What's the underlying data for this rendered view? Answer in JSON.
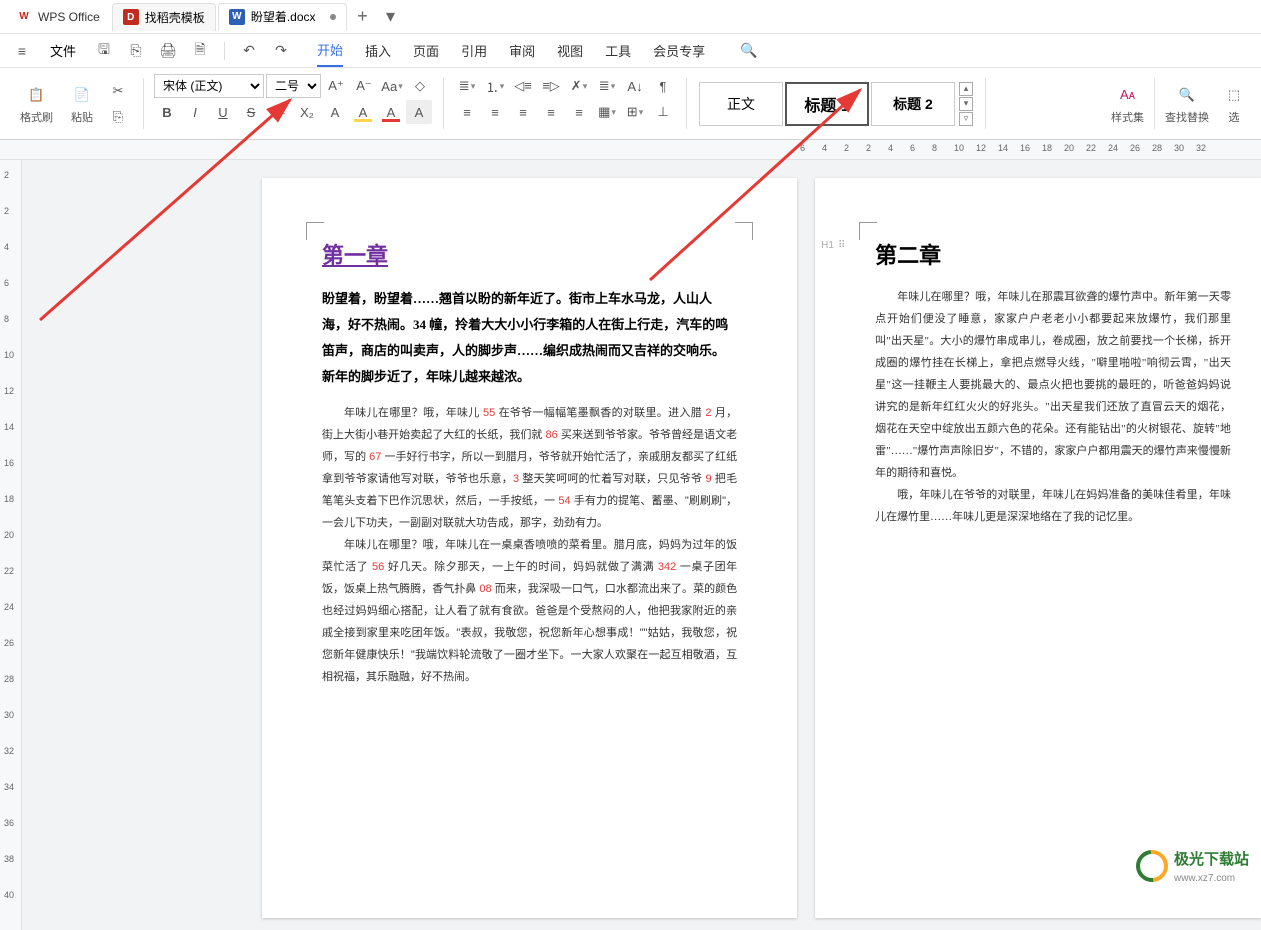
{
  "app": {
    "name": "WPS Office"
  },
  "tabs": {
    "template": "找稻壳模板",
    "doc": "盼望着.docx",
    "add": "+"
  },
  "menu": {
    "file": "文件",
    "items": [
      "开始",
      "插入",
      "页面",
      "引用",
      "审阅",
      "视图",
      "工具",
      "会员专享"
    ],
    "active": 0
  },
  "toolbar": {
    "format_painter": "格式刷",
    "paste": "粘贴",
    "font_name": "宋体 (正文)",
    "font_size": "二号",
    "aplus": "A⁺",
    "aminus": "A⁻",
    "bold": "B",
    "italic": "I",
    "underline": "U",
    "strike": "S",
    "x2": "X²",
    "x2b": "X₂",
    "clear": "A",
    "charbox": "A",
    "colorA": "A",
    "hlA": "A",
    "boxA": "A",
    "body_style": "正文",
    "h1_style": "标题 1",
    "h2_style": "标题 2",
    "styles": "样式集",
    "find": "查找替换",
    "select": "选"
  },
  "ruler": {
    "h": [
      "6",
      "4",
      "2",
      "2",
      "4",
      "6",
      "8",
      "10",
      "12",
      "14",
      "16",
      "18",
      "20",
      "22",
      "24",
      "26",
      "28",
      "30",
      "32"
    ],
    "v": [
      "2",
      "2",
      "4",
      "6",
      "8",
      "10",
      "12",
      "14",
      "16",
      "18",
      "20",
      "22",
      "24",
      "26",
      "28",
      "30",
      "32",
      "34",
      "36",
      "38",
      "40"
    ]
  },
  "page1": {
    "h1": "第一章",
    "bold_para": "盼望着，盼望着……翘首以盼的新年近了。街市上车水马龙，人山人海，好不热闹。34 幢，拎着大大小小行李箱的人在街上行走，汽车的鸣笛声，商店的叫卖声，人的脚步声……编织成热闹而又吉祥的交响乐。新年的脚步近了，年味儿越来越浓。",
    "p2a": "年味儿在哪里？哦，年味儿 ",
    "p2n1": "55",
    "p2b": " 在爷爷一幅幅笔墨飘香的对联里。进入腊 ",
    "p2n2": "2",
    "p2c": " 月，街上大街小巷开始卖起了大红的长纸，我们就 ",
    "p2n3": "86",
    "p2d": " 买来送到爷爷家。爷爷曾经是语文老师，写的 ",
    "p2n4": "67",
    "p2e": " 一手好行书字，所以一到腊月，爷爷就开始忙活了，亲戚朋友都买了红纸拿到爷爷家请他写对联，爷爷也乐意，",
    "p2n5": "3",
    "p2f": " 整天笑呵呵的忙着写对联，只见爷爷 ",
    "p2n6": "9",
    "p2g": " 把毛笔笔头支着下巴作沉思状，然后，一手按纸，一 ",
    "p2n7": "54",
    "p2h": " 手有力的提笔、蓄墨、\"刷刷刷\"，一会儿下功夫，一副副对联就大功告成，那字，劲劲有力。",
    "p3a": "年味儿在哪里？哦，年味儿在一桌桌香喷喷的菜肴里。腊月底，妈妈为过年的饭菜忙活了 ",
    "p3n1": "56",
    "p3b": " 好几天。除夕那天，一上午的时间，妈妈就做了满满 ",
    "p3n2": "342",
    "p3c": " 一桌子团年饭，饭桌上热气腾腾，香气扑鼻 ",
    "p3n3": "08",
    "p3d": " 而来，我深吸一口气，口水都流出来了。菜的颜色也经过妈妈细心搭配，让人看了就有食欲。爸爸是个受熬闷的人，他把我家附近的亲戚全接到家里来吃团年饭。\"表叔，我敬您，祝您新年心想事成！\"\"姑姑，我敬您，祝您新年健康快乐！\"我端饮料轮流敬了一圈才坐下。一大家人欢聚在一起互相敬酒，互相祝福，其乐融融，好不热闹。"
  },
  "page2": {
    "h1": "第二章",
    "h1_ind": "H1",
    "p1": "年味儿在哪里？哦，年味儿在那震耳欲聋的爆竹声中。新年第一天零点开始们便没了睡意，家家户户老老小小都要起来放爆竹，我们那里叫\"出天星\"。大小的爆竹串成串儿，卷成圈，放之前要找一个长梯，拆开成圈的爆竹挂在长梯上，拿把点燃导火线，\"噼里啪啦\"响彻云霄，\"出天星\"这一挂鞭主人要挑最大的、最点火把也要挑的最旺的，听爸爸妈妈说讲究的是新年红红火火的好兆头。\"出天星我们还放了直冒云天的烟花，烟花在天空中绽放出五颜六色的花朵。还有能钻出\"的火树银花、旋转\"地雷\"……\"爆竹声声除旧岁\"，不错的，家家户户都用震天的爆竹声来慢慢新年的期待和喜悦。",
    "p2": "哦，年味儿在爷爷的对联里，年味儿在妈妈准备的美味佳肴里，年味儿在爆竹里……年味儿更是深深地络在了我的记忆里。"
  },
  "watermark": {
    "t1": "极光下载站",
    "t2": "www.xz7.com"
  }
}
